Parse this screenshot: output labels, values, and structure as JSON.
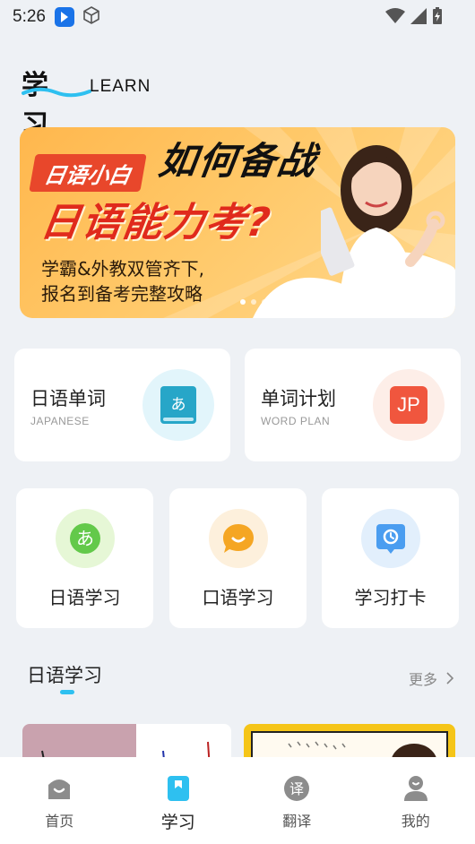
{
  "status_bar": {
    "time": "5:26"
  },
  "logo": {
    "cn": "学习",
    "en": "LEARN"
  },
  "banner": {
    "tag": "日语小白",
    "title_line1": "如何备战",
    "title_line2": "日语能力考?",
    "subtitle_line1": "学霸&外教双管齐下,",
    "subtitle_line2": "报名到备考完整攻略",
    "active_slide": 1,
    "slide_count": 3
  },
  "big_cards": [
    {
      "title": "日语单词",
      "subtitle": "JAPANESE",
      "icon": "kana-book-icon",
      "icon_text": "あ"
    },
    {
      "title": "单词计划",
      "subtitle": "WORD PLAN",
      "icon": "jp-icon",
      "icon_text": "JP"
    }
  ],
  "small_cards": [
    {
      "label": "日语学习",
      "icon": "kana-circle-icon",
      "icon_text": "あ"
    },
    {
      "label": "口语学习",
      "icon": "speech-bubble-icon"
    },
    {
      "label": "学习打卡",
      "icon": "location-pin-icon"
    }
  ],
  "section": {
    "title": "日语学习",
    "more": "更多"
  },
  "bottom_nav": [
    {
      "label": "首页",
      "icon": "home-icon",
      "active": false
    },
    {
      "label": "学习",
      "icon": "bookmark-book-icon",
      "active": true
    },
    {
      "label": "翻译",
      "icon": "translate-icon",
      "icon_text": "译",
      "active": false
    },
    {
      "label": "我的",
      "icon": "profile-icon",
      "active": false
    }
  ],
  "colors": {
    "accent": "#2ec0f0",
    "banner_red": "#e02a1c",
    "background": "#eef1f5"
  }
}
